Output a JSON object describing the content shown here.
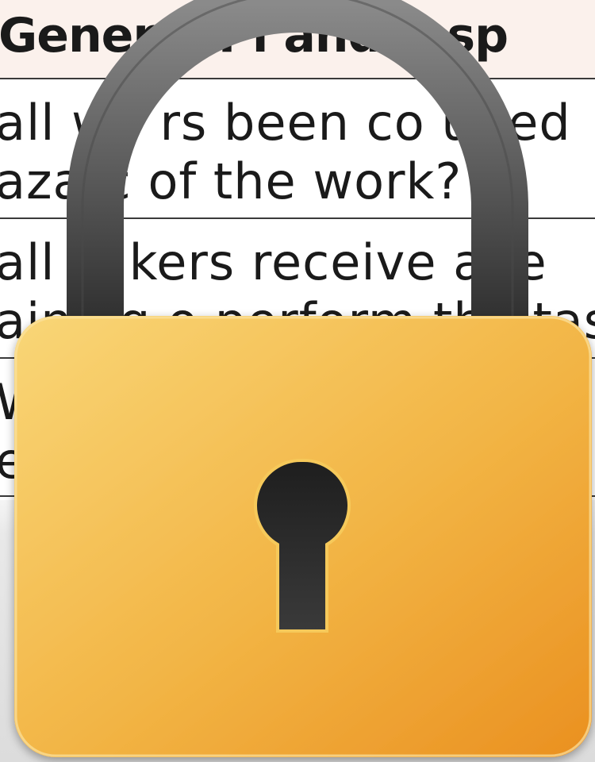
{
  "document": {
    "header_text": "General Pl      and Insp",
    "rows": [
      [
        "all wo    rs been co    ulted",
        "azarc   of the work?"
      ],
      [
        "all  w    kers  receive    ade",
        "aining  o perform the  task"
      ],
      [
        "W",
        "e"
      ]
    ]
  },
  "lock": {
    "icon": "padlock-icon",
    "body_color_light": "#f8d470",
    "body_color_dark": "#eb9525",
    "shackle_color": "#5a5a5a",
    "keyhole_color": "#222222"
  }
}
